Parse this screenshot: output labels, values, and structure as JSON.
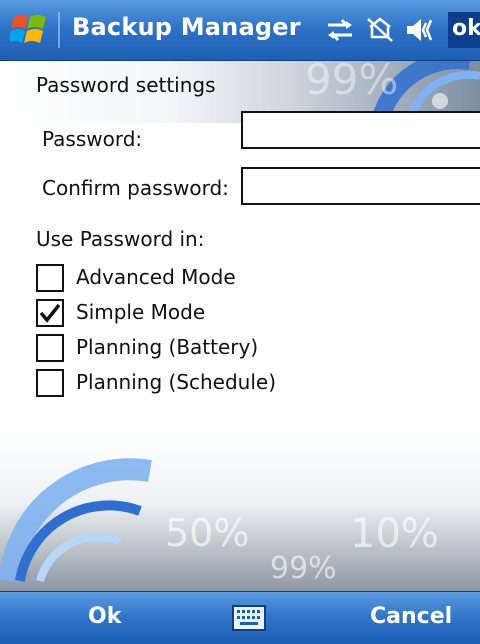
{
  "titlebar": {
    "app_title": "Backup Manager",
    "ok_label": "ok",
    "icons": [
      "windows-start-icon",
      "connectivity-icon",
      "signal-icon",
      "volume-icon"
    ]
  },
  "content": {
    "section_title": "Password settings",
    "password_label": "Password:",
    "password_value": "",
    "confirm_label": "Confirm password:",
    "confirm_value": "",
    "use_in_label": "Use Password in:",
    "options": [
      {
        "label": "Advanced Mode",
        "checked": false
      },
      {
        "label": "Simple Mode",
        "checked": true
      },
      {
        "label": "Planning (Battery)",
        "checked": false
      },
      {
        "label": "Planning (Schedule)",
        "checked": false
      }
    ],
    "background_text": [
      "50%",
      "10%",
      "99%"
    ]
  },
  "menubar": {
    "left_softkey": "Ok",
    "right_softkey": "Cancel",
    "sip_icon": "keyboard-icon"
  },
  "colors": {
    "bar_top": "#5a9ae0",
    "bar_bottom": "#1d5fb3",
    "accent": "#0d3d8c"
  }
}
